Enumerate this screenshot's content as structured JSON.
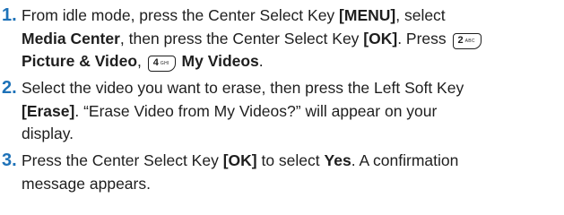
{
  "accent_color": "#1e72b8",
  "keys": {
    "key2": {
      "digit": "2",
      "letters": "ABC"
    },
    "key4": {
      "digit": "4",
      "letters": "GHI"
    }
  },
  "steps": [
    {
      "number": "1.",
      "line1_a": "From idle mode, press the Center Select Key ",
      "line1_b": "[MENU]",
      "line1_c": ", select",
      "line2_a": "Media Center",
      "line2_b": ", then press the Center Select Key ",
      "line2_c": "[OK]",
      "line2_d": ". Press ",
      "line3_a": "Picture & Video",
      "line3_b": ", ",
      "line3_c": " My Videos",
      "line3_d": "."
    },
    {
      "number": "2.",
      "line1_a": "Select the video you want to erase, then press the Left Soft Key",
      "line2_a": "[Erase]",
      "line2_b": ". “Erase Video from My Videos?” will appear on your",
      "line3_a": "display."
    },
    {
      "number": "3.",
      "line1_a": "Press the Center Select Key ",
      "line1_b": "[OK]",
      "line1_c": " to select ",
      "line1_d": "Yes",
      "line1_e": ". A confirmation",
      "line2_a": "message appears."
    }
  ]
}
